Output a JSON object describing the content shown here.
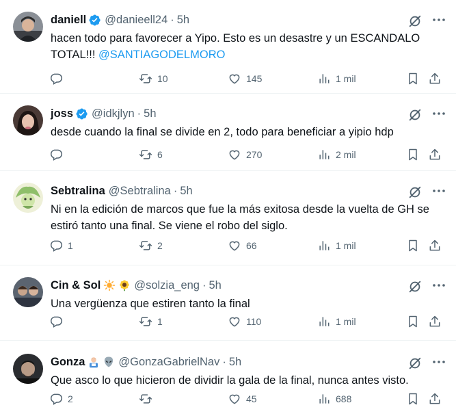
{
  "colors": {
    "verified": "#1d9bf0",
    "mention": "#1d9bf0",
    "muted": "#536471",
    "divider": "#eff3f4"
  },
  "icons": {
    "reply": "reply-icon",
    "retweet": "retweet-icon",
    "like": "heart-icon",
    "views": "views-chart-icon",
    "bookmark": "bookmark-icon",
    "share": "share-icon",
    "grok": "grok-icon",
    "verified": "verified-badge-icon"
  },
  "tweets": [
    {
      "name": "daniell",
      "handle": "@danieell24",
      "time": "5h",
      "text": "hacen todo para favorecer a Yipo. Esto es un desastre y un ESCANDALO TOTAL!!! ",
      "mention": "@SANTIAGODELMORO",
      "replies": "",
      "retweets": "10",
      "likes": "145",
      "views": "1 mil"
    },
    {
      "name": "joss",
      "handle": "@idkjlyn",
      "time": "5h",
      "text": "desde cuando la final se divide en 2, todo para beneficiar a yipio hdp",
      "replies": "",
      "retweets": "6",
      "likes": "270",
      "views": "2 mil"
    },
    {
      "name": "Sebtralina",
      "handle": "@Sebtralina",
      "time": "5h",
      "text": "Ni en la edición de marcos que fue la más exitosa desde la vuelta de GH se estiró tanto una final. Se viene el robo del siglo.",
      "replies": "1",
      "retweets": "2",
      "likes": "66",
      "views": "1 mil"
    },
    {
      "name": "Cin & Sol",
      "handle": "@solzia_eng",
      "time": "5h",
      "text": "Una vergüenza que estiren tanto la final",
      "replies": "",
      "retweets": "1",
      "likes": "110",
      "views": "1 mil"
    },
    {
      "name": "Gonza",
      "handle": "@GonzaGabrielNav",
      "time": "5h",
      "text": "Que asco lo que hicieron de dividir la gala de la final, nunca antes visto.",
      "replies": "2",
      "retweets": "",
      "likes": "45",
      "views": "688"
    }
  ]
}
